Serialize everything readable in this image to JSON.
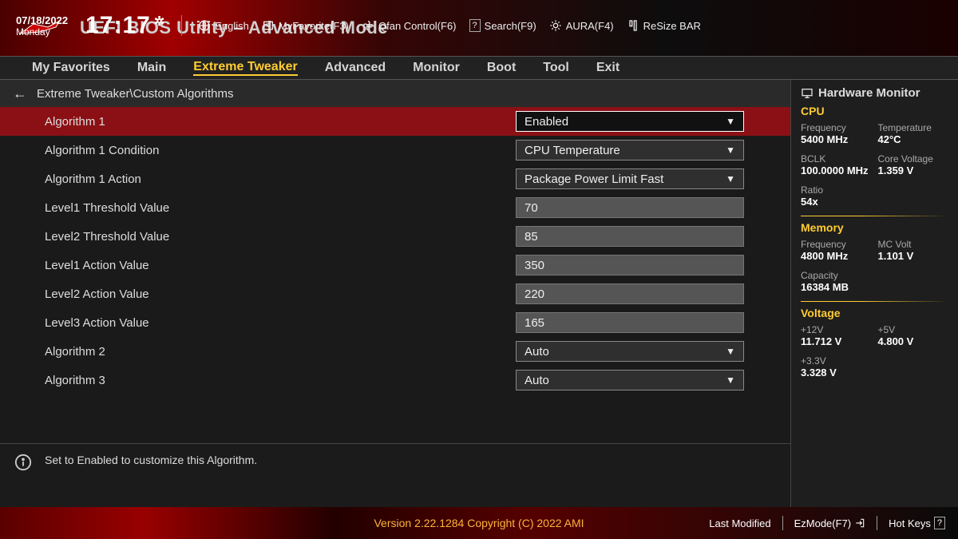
{
  "header": {
    "title": "UEFI BIOS Utility – Advanced Mode",
    "date": "07/18/2022",
    "day": "Monday",
    "time": "17:17",
    "toolbar": {
      "language": "English",
      "favorite": "MyFavorite(F3)",
      "qfan": "Qfan Control(F6)",
      "search": "Search(F9)",
      "aura": "AURA(F4)",
      "resize": "ReSize BAR"
    }
  },
  "tabs": [
    "My Favorites",
    "Main",
    "Extreme Tweaker",
    "Advanced",
    "Monitor",
    "Boot",
    "Tool",
    "Exit"
  ],
  "breadcrumb": "Extreme Tweaker\\Custom Algorithms",
  "rows": {
    "r0": {
      "label": "Algorithm 1",
      "type": "select",
      "value": "Enabled"
    },
    "r1": {
      "label": "Algorithm 1 Condition",
      "type": "select",
      "value": "CPU Temperature"
    },
    "r2": {
      "label": "Algorithm 1 Action",
      "type": "select",
      "value": "Package Power Limit Fast"
    },
    "r3": {
      "label": "Level1 Threshold Value",
      "type": "input",
      "value": "70"
    },
    "r4": {
      "label": "Level2 Threshold Value",
      "type": "input",
      "value": "85"
    },
    "r5": {
      "label": "Level1 Action Value",
      "type": "input",
      "value": "350"
    },
    "r6": {
      "label": "Level2 Action Value",
      "type": "input",
      "value": "220"
    },
    "r7": {
      "label": "Level3 Action Value",
      "type": "input",
      "value": "165"
    },
    "r8": {
      "label": "Algorithm 2",
      "type": "select",
      "value": "Auto"
    },
    "r9": {
      "label": "Algorithm 3",
      "type": "select",
      "value": "Auto"
    }
  },
  "info": "Set to Enabled to customize this Algorithm.",
  "side": {
    "title": "Hardware Monitor",
    "cpu": {
      "head": "CPU",
      "freq_l": "Frequency",
      "freq_v": "5400 MHz",
      "temp_l": "Temperature",
      "temp_v": "42°C",
      "bclk_l": "BCLK",
      "bclk_v": "100.0000 MHz",
      "corev_l": "Core Voltage",
      "corev_v": "1.359 V",
      "ratio_l": "Ratio",
      "ratio_v": "54x"
    },
    "mem": {
      "head": "Memory",
      "freq_l": "Frequency",
      "freq_v": "4800 MHz",
      "mcv_l": "MC Volt",
      "mcv_v": "1.101 V",
      "cap_l": "Capacity",
      "cap_v": "16384 MB"
    },
    "volt": {
      "head": "Voltage",
      "v12_l": "+12V",
      "v12_v": "11.712 V",
      "v5_l": "+5V",
      "v5_v": "4.800 V",
      "v33_l": "+3.3V",
      "v33_v": "3.328 V"
    }
  },
  "footer": {
    "version": "Version 2.22.1284 Copyright (C) 2022 AMI",
    "last_modified": "Last Modified",
    "ezmode": "EzMode(F7)",
    "hotkeys": "Hot Keys"
  }
}
